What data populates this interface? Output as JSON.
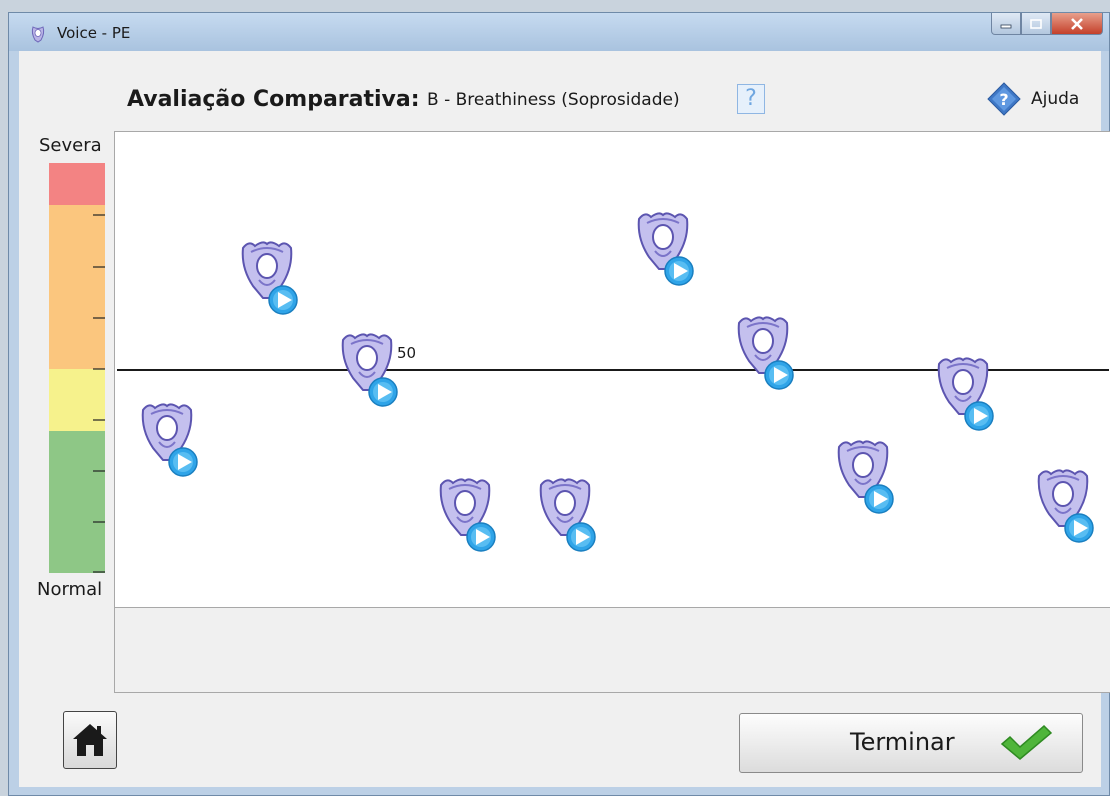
{
  "window": {
    "title": "Voice - PE",
    "app_icon": "larynx-icon",
    "controls": [
      "minimize-icon",
      "maximize-icon",
      "close-icon"
    ]
  },
  "header": {
    "label": "Avaliação Comparativa:",
    "value": "B - Breathiness (Soprosidade)",
    "info_icon": "question-mark-icon",
    "info_glyph": "?",
    "help_label": "Ajuda",
    "help_icon": "help-diamond-icon"
  },
  "scale": {
    "top_label": "Severa",
    "bottom_label": "Normal",
    "colors": {
      "severe": "#f38383",
      "moderate": "#fbc67e",
      "mild": "#f6f28c",
      "normal": "#8ec786"
    }
  },
  "plot": {
    "reference_value_label": "50",
    "reference_level": 0.5,
    "samples": [
      {
        "name": "sample-1",
        "level": 0.33
      },
      {
        "name": "sample-2",
        "level": 0.72
      },
      {
        "name": "sample-3",
        "level": 0.5
      },
      {
        "name": "sample-4",
        "level": 0.15
      },
      {
        "name": "sample-5",
        "level": 0.15
      },
      {
        "name": "sample-6",
        "level": 0.79
      },
      {
        "name": "sample-7",
        "level": 0.54
      },
      {
        "name": "sample-8",
        "level": 0.24
      },
      {
        "name": "sample-9",
        "level": 0.44
      },
      {
        "name": "sample-10",
        "level": 0.17
      }
    ]
  },
  "footer": {
    "home_icon": "home-icon",
    "finish_label": "Terminar",
    "finish_icon": "checkmark-icon"
  }
}
